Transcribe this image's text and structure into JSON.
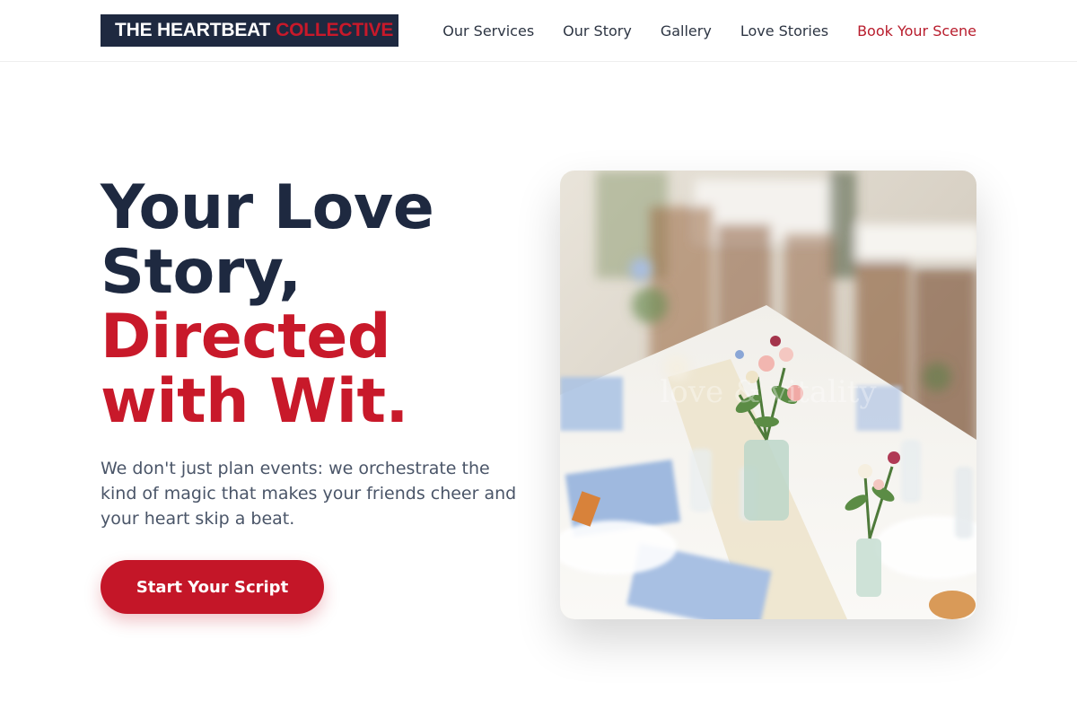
{
  "header": {
    "logo_main": "THE HEARTBEAT",
    "logo_accent": "COLLECTIVE",
    "nav": {
      "services": "Our Services",
      "story": "Our Story",
      "gallery": "Gallery",
      "love_stories": "Love Stories",
      "book": "Book Your Scene"
    }
  },
  "hero": {
    "headline_line1": "Your Love",
    "headline_line2": "Story,",
    "headline_line3": "Directed",
    "headline_line4": "with Wit.",
    "subtext": "We don't just plan events: we orchestrate the kind of magic that makes your friends cheer and your heart skip a beat.",
    "cta_label": "Start Your Script",
    "image_watermark": "love & vitality"
  },
  "colors": {
    "navy": "#1e2940",
    "brand_red": "#c8192a",
    "body_text": "#4a5568"
  }
}
